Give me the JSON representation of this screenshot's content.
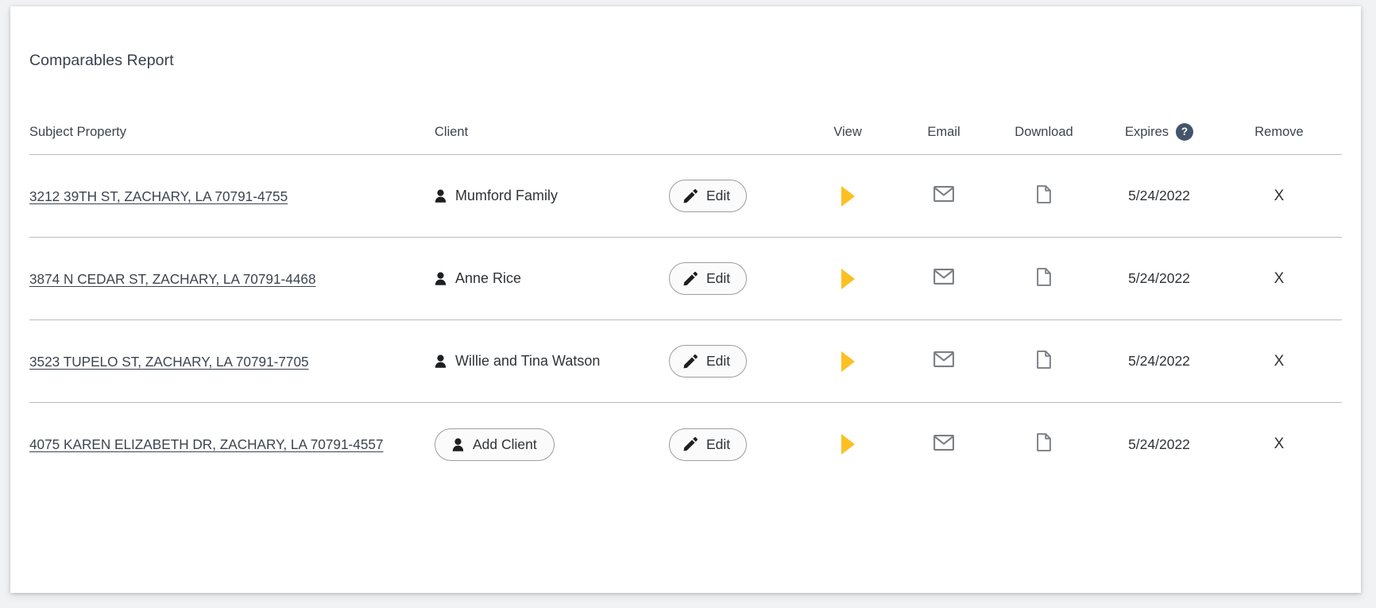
{
  "card": {
    "title": "Comparables Report"
  },
  "table": {
    "columns": {
      "subject": "Subject Property",
      "client": "Client",
      "edit": "",
      "view": "View",
      "email": "Email",
      "download": "Download",
      "expires": "Expires",
      "expires_help": "?",
      "remove": "Remove"
    },
    "rows": [
      {
        "address": "3212 39TH ST, ZACHARY, LA 70791-4755",
        "client": "Mumford Family",
        "client_has_button": false,
        "client_button_label": "",
        "edit_label": "Edit",
        "expires": "5/24/2022",
        "remove_label": "X"
      },
      {
        "address": "3874 N CEDAR ST, ZACHARY, LA 70791-4468",
        "client": "Anne Rice",
        "client_has_button": false,
        "client_button_label": "",
        "edit_label": "Edit",
        "expires": "5/24/2022",
        "remove_label": "X"
      },
      {
        "address": "3523 TUPELO ST, ZACHARY, LA 70791-7705",
        "client": "Willie and Tina Watson",
        "client_has_button": false,
        "client_button_label": "",
        "edit_label": "Edit",
        "expires": "5/24/2022",
        "remove_label": "X"
      },
      {
        "address": "4075 KAREN ELIZABETH DR, ZACHARY, LA 70791-4557",
        "client": "",
        "client_has_button": true,
        "client_button_label": "Add Client",
        "edit_label": "Edit",
        "expires": "5/24/2022",
        "remove_label": "X"
      }
    ]
  },
  "icons": {
    "person": "person-icon",
    "pencil": "pencil-icon",
    "play": "play-triangle-icon",
    "envelope": "envelope-icon",
    "document": "document-icon",
    "help": "help-circle-icon"
  },
  "colors": {
    "accent_play": "#fcc025",
    "help_badge": "#44546a",
    "icon_gray": "#7b7f84",
    "text": "#2f3337",
    "divider": "#b9bbbd",
    "page_bg": "#f1f2f4",
    "card_bg": "#ffffff"
  }
}
